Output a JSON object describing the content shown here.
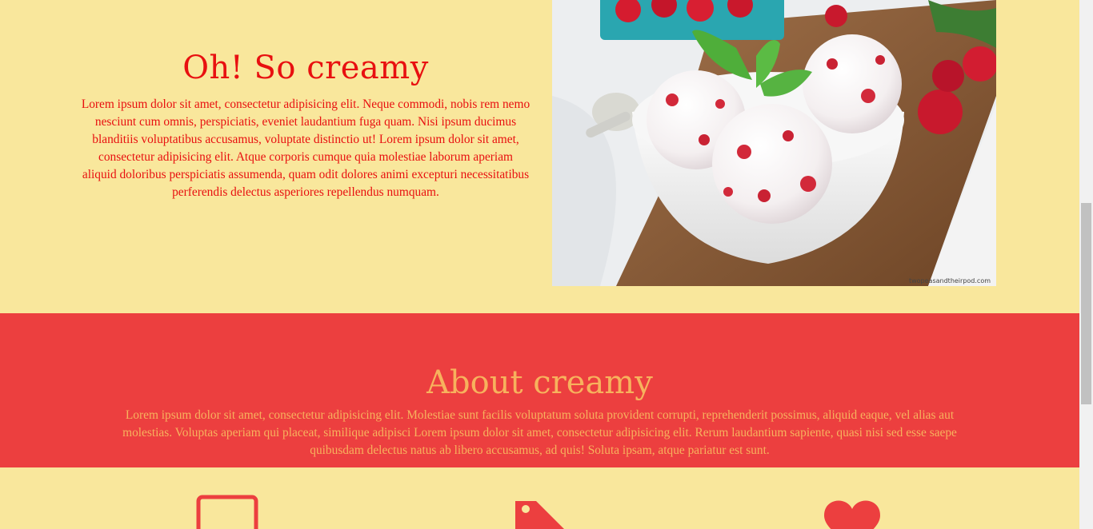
{
  "hero": {
    "title": "Oh! So creamy",
    "paragraph": "Lorem ipsum dolor sit amet, consectetur adipisicing elit. Neque commodi, nobis rem nemo nesciunt cum omnis, perspiciatis, eveniet laudantium fuga quam. Nisi ipsum ducimus blanditiis voluptatibus accusamus, voluptate distinctio ut! Lorem ipsum dolor sit amet, consectetur adipisicing elit. Atque corporis cumque quia molestiae laborum aperiam aliquid doloribus perspiciatis assumenda, quam odit dolores animi excepturi necessitatibus perferendis delectus asperiores repellendus numquam.",
    "image_credit": "twopeasandtheirpod.com"
  },
  "about": {
    "title": "About creamy",
    "paragraph": "Lorem ipsum dolor sit amet, consectetur adipisicing elit. Molestiae sunt facilis voluptatum soluta provident corrupti, reprehenderit possimus, aliquid eaque, vel alias aut molestias. Voluptas aperiam qui placeat, similique adipisci Lorem ipsum dolor sit amet, consectetur adipisicing elit. Rerum laudantium sapiente, quasi nisi sed esse saepe quibusdam delectus natus ab libero accusamus, ad quis! Soluta ipsam, atque pariatur est sunt."
  },
  "features": {
    "icons": [
      "laptop-icon",
      "tag-icon",
      "heart-icon"
    ]
  },
  "colors": {
    "background": "#f9e79c",
    "accent_red": "#ec3f3f",
    "hero_text": "#e81010",
    "about_text": "#f7b25d"
  }
}
